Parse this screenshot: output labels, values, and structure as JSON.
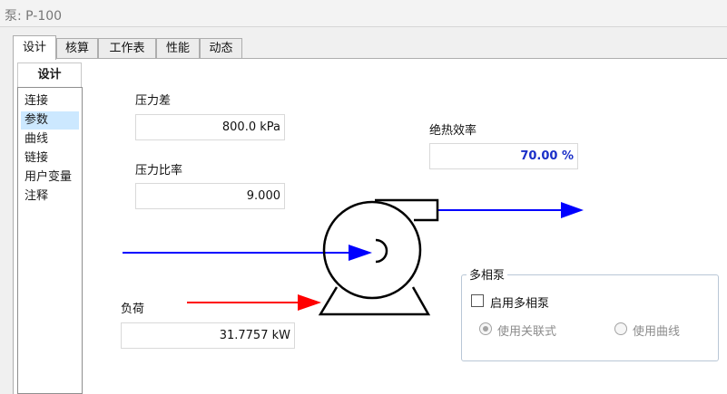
{
  "window": {
    "title": "泵: P-100"
  },
  "tabs": [
    {
      "label": "设计",
      "active": true
    },
    {
      "label": "核算",
      "active": false
    },
    {
      "label": "工作表",
      "active": false
    },
    {
      "label": "性能",
      "active": false
    },
    {
      "label": "动态",
      "active": false
    }
  ],
  "nav": {
    "header": "设计",
    "items": [
      {
        "label": "连接",
        "selected": false
      },
      {
        "label": "参数",
        "selected": true
      },
      {
        "label": "曲线",
        "selected": false
      },
      {
        "label": "链接",
        "selected": false
      },
      {
        "label": "用户变量",
        "selected": false
      },
      {
        "label": "注释",
        "selected": false
      }
    ]
  },
  "params": {
    "pressure_diff_label": "压力差",
    "pressure_diff_value": "800.0 kPa",
    "pressure_ratio_label": "压力比率",
    "pressure_ratio_value": "9.000",
    "efficiency_label": "绝热效率",
    "efficiency_value": "70.00 %",
    "duty_label": "负荷",
    "duty_value": "31.7757 kW"
  },
  "multiphase": {
    "title": "多相泵",
    "enable_label": "启用多相泵",
    "enable_checked": false,
    "option_correlation": "使用关联式",
    "option_curve": "使用曲线",
    "selected_option": "使用关联式"
  },
  "colors": {
    "material_stream": "#0000ff",
    "energy_stream": "#ff0000",
    "efficiency_text": "#1a2fc8"
  }
}
